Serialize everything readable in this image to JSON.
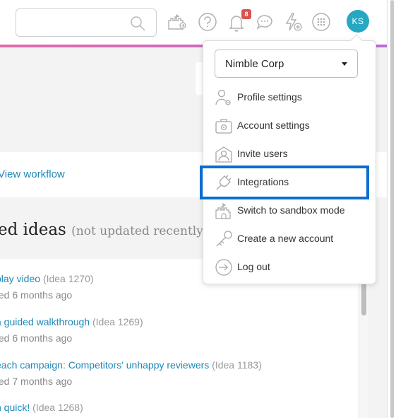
{
  "topbar": {
    "search_value": "",
    "search_placeholder": "",
    "notification_count": "8",
    "avatar_initials": "KS"
  },
  "page": {
    "workflow_link": "View workflow",
    "heading_main": "ed ideas",
    "heading_sub": "(not updated recently)",
    "ideas": [
      {
        "title": "play video",
        "idea_id": "(Idea 1270)",
        "meta": "ted 6 months ago"
      },
      {
        "title": "a guided walkthrough",
        "idea_id": "(Idea 1269)",
        "meta": "ted 6 months ago"
      },
      {
        "title": "each campaign: Competitors' unhappy reviewers",
        "idea_id": "(Idea 1183)",
        "meta": "ted 7 months ago"
      },
      {
        "title": "h quick!",
        "idea_id": "(Idea 1268)",
        "meta": ""
      }
    ]
  },
  "menu": {
    "account_selected": "Nimble Corp",
    "items": [
      {
        "label": "Profile settings",
        "icon": "user-gear-icon"
      },
      {
        "label": "Account settings",
        "icon": "briefcase-gear-icon"
      },
      {
        "label": "Invite users",
        "icon": "envelope-user-icon"
      },
      {
        "label": "Integrations",
        "icon": "plug-icon"
      },
      {
        "label": "Switch to sandbox mode",
        "icon": "sandcastle-icon"
      },
      {
        "label": "Create a new account",
        "icon": "key-icon"
      },
      {
        "label": "Log out",
        "icon": "logout-icon"
      }
    ],
    "highlighted_item": "Integrations"
  },
  "colors": {
    "accent": "#26a8c3",
    "link": "#1e88b8",
    "highlight": "#0a6ed1",
    "badge": "#d9534f"
  }
}
